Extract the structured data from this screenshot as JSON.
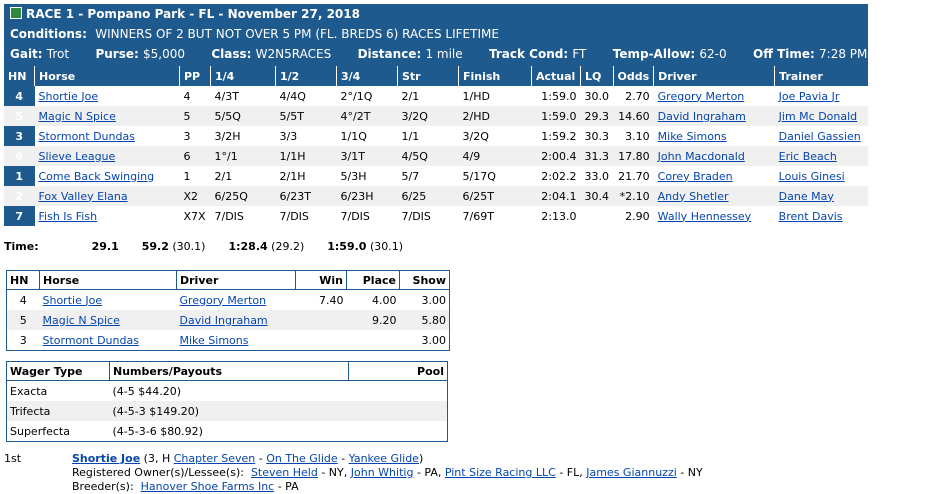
{
  "header": {
    "race": "RACE 1 - Pompano Park - FL - November 27, 2018",
    "conditions_label": "Conditions:",
    "conditions": "WINNERS OF 2 BUT NOT OVER 5 PM (FL. BREDS 6) RACES LIFETIME",
    "gait_label": "Gait:",
    "gait": "Trot",
    "purse_label": "Purse:",
    "purse": "$5,000",
    "class_label": "Class:",
    "class": "W2N5RACES",
    "distance_label": "Distance:",
    "distance": "1 mile",
    "track_label": "Track Cond:",
    "track": "FT",
    "temp_label": "Temp-Allow:",
    "temp": "62-0",
    "off_label": "Off Time:",
    "off": "7:28 PM"
  },
  "results": {
    "columns": [
      "HN",
      "Horse",
      "PP",
      "1/4",
      "1/2",
      "3/4",
      "Str",
      "Finish",
      "Actual",
      "LQ",
      "Odds",
      "Driver",
      "Trainer"
    ],
    "rows": [
      [
        "4",
        "Shortie Joe",
        "4",
        "4/3T",
        "4/4Q",
        "2°/1Q",
        "2/1",
        "1/HD",
        "1:59.0",
        "30.0",
        "2.70",
        "Gregory Merton",
        "Joe Pavia Jr"
      ],
      [
        "5",
        "Magic N Spice",
        "5",
        "5/5Q",
        "5/5T",
        "4°/2T",
        "3/2Q",
        "2/HD",
        "1:59.0",
        "29.3",
        "14.60",
        "David Ingraham",
        "Jim Mc Donald"
      ],
      [
        "3",
        "Stormont Dundas",
        "3",
        "3/2H",
        "3/3",
        "1/1Q",
        "1/1",
        "3/2Q",
        "1:59.2",
        "30.3",
        "3.10",
        "Mike Simons",
        "Daniel Gassien"
      ],
      [
        "6",
        "Slieve League",
        "6",
        "1°/1",
        "1/1H",
        "3/1T",
        "4/5Q",
        "4/9",
        "2:00.4",
        "31.3",
        "17.80",
        "John Macdonald",
        "Eric Beach"
      ],
      [
        "1",
        "Come Back Swinging",
        "1",
        "2/1",
        "2/1H",
        "5/3H",
        "5/7",
        "5/17Q",
        "2:02.2",
        "33.0",
        "21.70",
        "Corey Braden",
        "Louis Ginesi"
      ],
      [
        "2",
        "Fox Valley Elana",
        "X2",
        "6/25Q",
        "6/23T",
        "6/23H",
        "6/25",
        "6/25T",
        "2:04.1",
        "30.4",
        "*2.10",
        "Andy Shetler",
        "Dane May"
      ],
      [
        "7",
        "Fish Is Fish",
        "X7X",
        "7/DIS",
        "7/DIS",
        "7/DIS",
        "7/DIS",
        "7/69T",
        "2:13.0",
        "",
        "2.90",
        "Wally Hennessey",
        "Brent Davis"
      ]
    ]
  },
  "times": {
    "label": "Time:",
    "t1": "29.1",
    "t2": "59.2",
    "t2b": "(30.1)",
    "t3": "1:28.4",
    "t3b": "(29.2)",
    "t4": "1:59.0",
    "t4b": "(30.1)"
  },
  "payouts": {
    "columns": [
      "HN",
      "Horse",
      "Driver",
      "Win",
      "Place",
      "Show"
    ],
    "rows": [
      [
        "4",
        "Shortie Joe",
        "Gregory Merton",
        "7.40",
        "4.00",
        "3.00"
      ],
      [
        "5",
        "Magic N Spice",
        "David Ingraham",
        "",
        "9.20",
        "5.80"
      ],
      [
        "3",
        "Stormont Dundas",
        "Mike Simons",
        "",
        "",
        "3.00"
      ]
    ]
  },
  "wagers": {
    "columns": [
      "Wager Type",
      "Numbers/Payouts",
      "Pool"
    ],
    "rows": [
      [
        "Exacta",
        "(4-5 $44.20)",
        ""
      ],
      [
        "Trifecta",
        "(4-5-3 $149.20)",
        ""
      ],
      [
        "Superfecta",
        "(4-5-3-6 $80.92)",
        ""
      ]
    ]
  },
  "winner": {
    "place": "1st",
    "horse": "Shortie Joe",
    "info": "(3, H",
    "sire": "Chapter Seven",
    "dam": "On The Glide",
    "damsire": "Yankee Glide",
    "close": ")",
    "owners_label": "Registered Owner(s)/Lessee(s):",
    "owners": [
      {
        "name": "Steven Held",
        "loc": "- NY,"
      },
      {
        "name": "John Whitig",
        "loc": "- PA,"
      },
      {
        "name": "Pint Size Racing LLC",
        "loc": "- FL,"
      },
      {
        "name": "James Giannuzzi",
        "loc": "- NY"
      }
    ],
    "breeder_label": "Breeder(s):",
    "breeder": "Hanover Shoe Farms Inc",
    "breeder_loc": "- PA"
  }
}
